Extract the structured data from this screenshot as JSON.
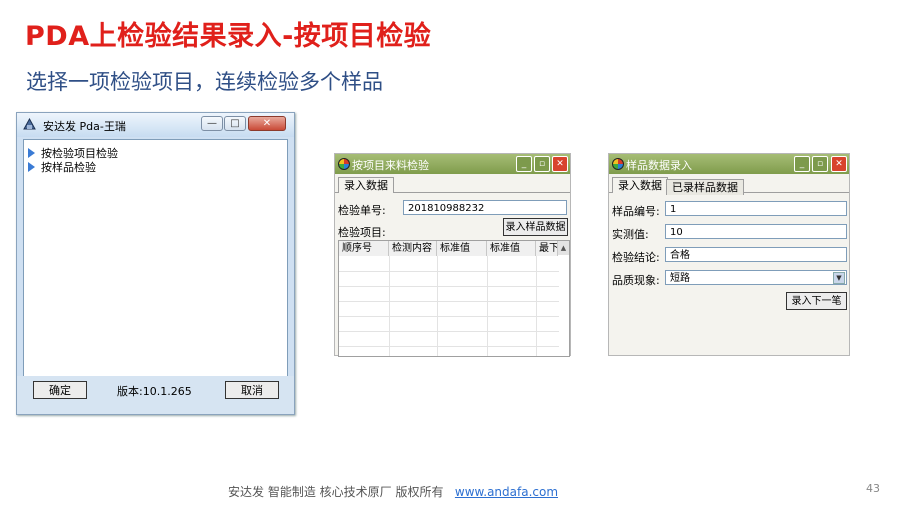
{
  "slide": {
    "title": "PDA上检验结果录入-按项目检验",
    "subtitle": "选择一项检验项目，连续检验多个样品",
    "footer_text": "安达发   智能制造 核心技术原厂    版权所有",
    "footer_link": "www.andafa.com",
    "page_number": "43"
  },
  "window_main": {
    "title": "安达发 Pda-王瑞",
    "controls": {
      "minimize": "—",
      "maximize": "□",
      "close": "✕"
    },
    "tree_items": [
      "按检验项目检验",
      "按样品检验"
    ],
    "ok_label": "确定",
    "version": "版本:10.1.265",
    "cancel_label": "取消"
  },
  "window_item": {
    "title": "按项目来料检验",
    "controls": {
      "minimize": "_",
      "maximize": "▫",
      "close": "✕"
    },
    "tabs": [
      "录入数据"
    ],
    "inspection_no_label": "检验单号:",
    "inspection_no_value": "201810988232",
    "inspection_item_label": "检验项目:",
    "enter_sample_button": "录入样品数据",
    "columns": [
      "顺序号",
      "检测内容",
      "标准值",
      "标准值",
      "最下"
    ]
  },
  "window_sample": {
    "title": "样品数据录入",
    "controls": {
      "minimize": "_",
      "maximize": "▫",
      "close": "✕"
    },
    "tabs": [
      "录入数据",
      "已录样品数据"
    ],
    "sample_no_label": "样品编号:",
    "sample_no_value": "1",
    "measured_label": "实测值:",
    "measured_value": "10",
    "conclusion_label": "检验结论:",
    "conclusion_value": "合格",
    "phenomenon_label": "品质现象:",
    "phenomenon_value": "短路",
    "next_button": "录入下一笔"
  },
  "colors": {
    "title_red": "#e0201b",
    "subtitle_blue": "#2f4f86",
    "xp_titlebar_green": "#8ba85a",
    "link_blue": "#2c6fd1"
  },
  "icons": [
    "app-icon",
    "expand-arrow-icon",
    "window-logo-icon",
    "dropdown-arrow-icon",
    "scroll-up-icon"
  ]
}
